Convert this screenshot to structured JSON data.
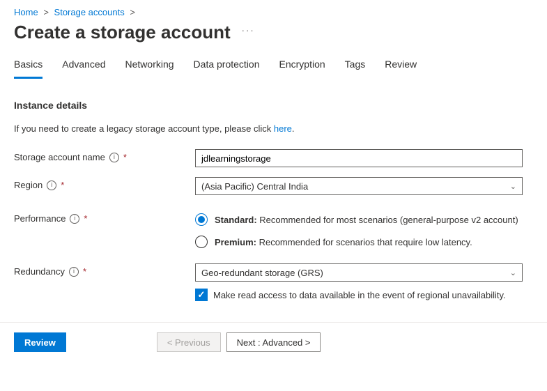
{
  "breadcrumb": {
    "home": "Home",
    "storage_accounts": "Storage accounts"
  },
  "title": "Create a storage account",
  "more": "···",
  "tabs": {
    "basics": "Basics",
    "advanced": "Advanced",
    "networking": "Networking",
    "data_protection": "Data protection",
    "encryption": "Encryption",
    "tags": "Tags",
    "review": "Review"
  },
  "section": {
    "instance_details": "Instance details"
  },
  "legacy": {
    "prefix": "If you need to create a legacy storage account type, please click ",
    "link": "here",
    "suffix": "."
  },
  "fields": {
    "storage_name_label": "Storage account name",
    "storage_name_value": "jdlearningstorage",
    "region_label": "Region",
    "region_value": "(Asia Pacific) Central India",
    "performance_label": "Performance",
    "perf_standard_title": "Standard:",
    "perf_standard_desc": " Recommended for most scenarios (general-purpose v2 account)",
    "perf_premium_title": "Premium:",
    "perf_premium_desc": " Recommended for scenarios that require low latency.",
    "redundancy_label": "Redundancy",
    "redundancy_value": "Geo-redundant storage (GRS)",
    "read_access_label": "Make read access to data available in the event of regional unavailability."
  },
  "footer": {
    "review": "Review",
    "previous": "< Previous",
    "next": "Next : Advanced >"
  }
}
